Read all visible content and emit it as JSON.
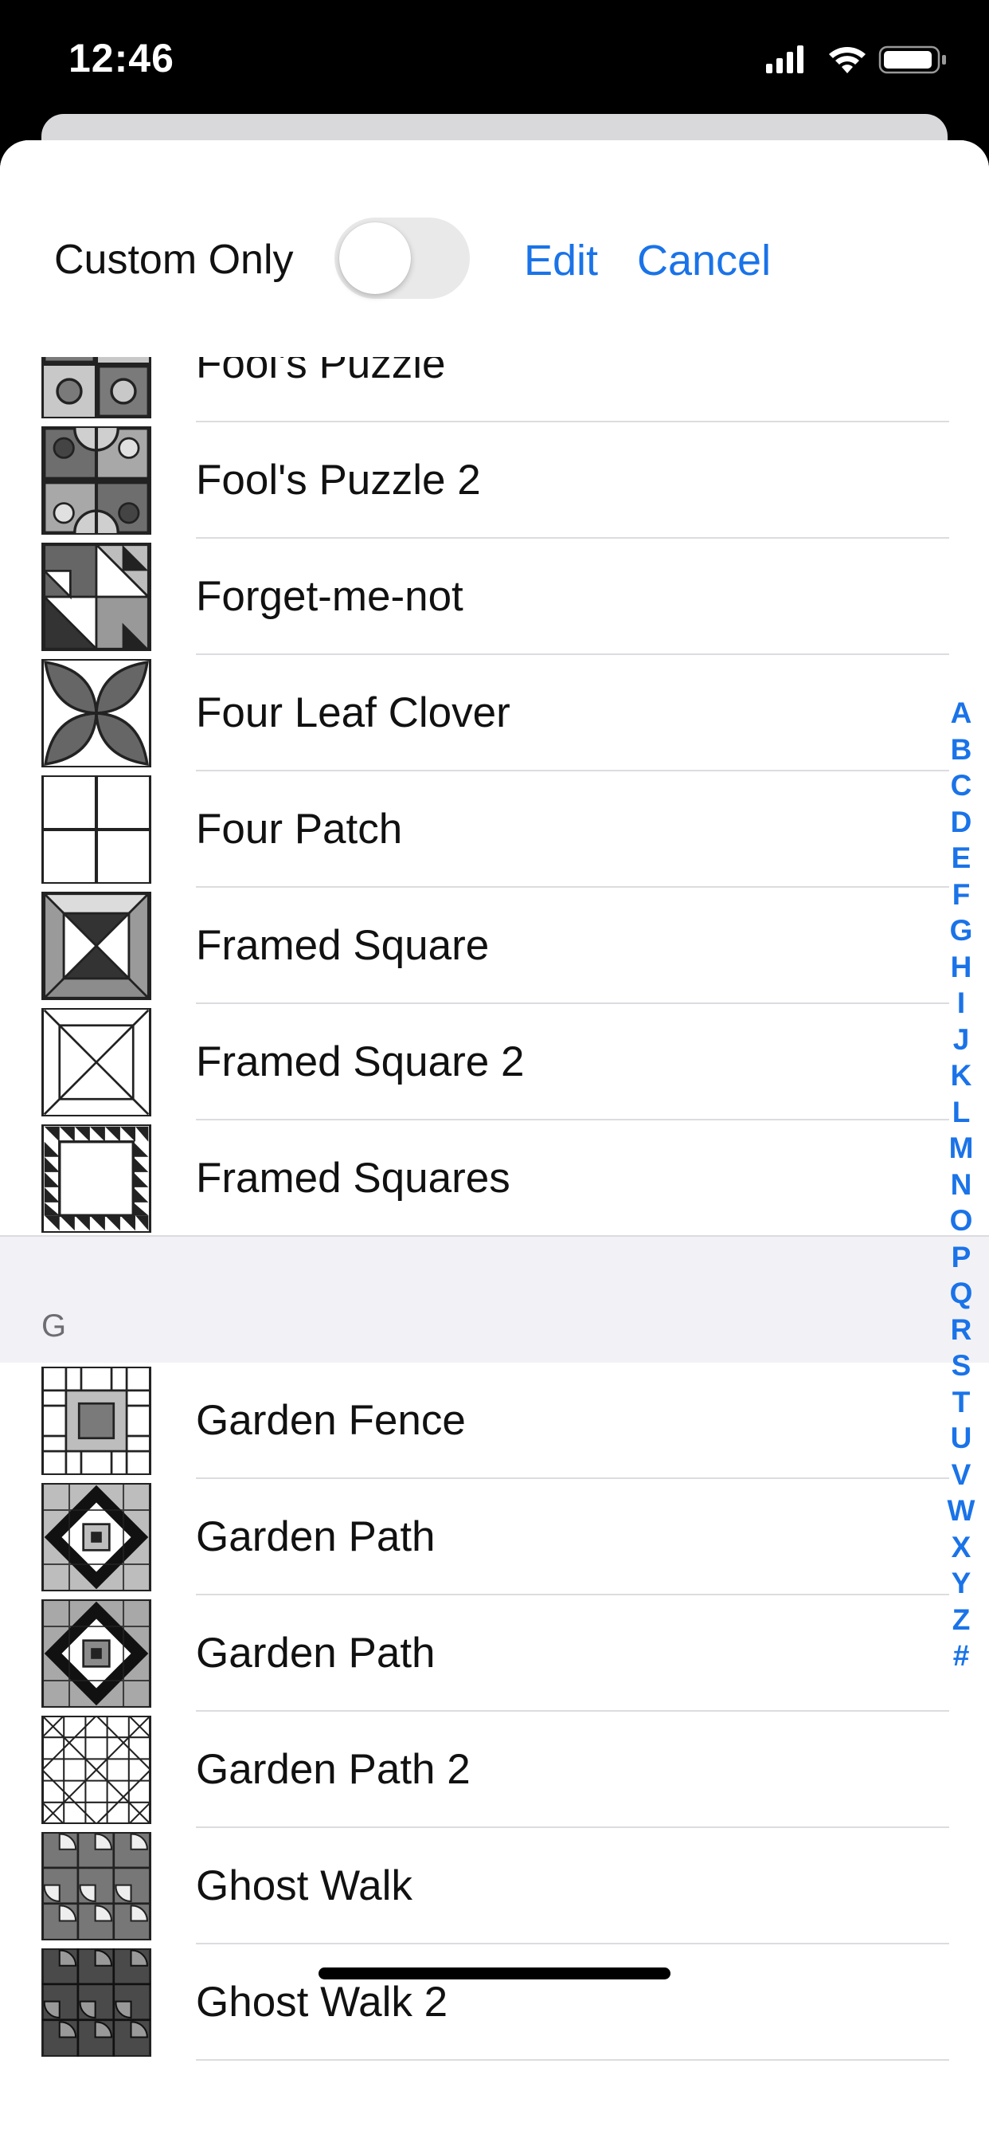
{
  "status_bar": {
    "time": "12:46"
  },
  "header": {
    "custom_only_label": "Custom Only",
    "custom_only_on": false,
    "edit_label": "Edit",
    "cancel_label": "Cancel"
  },
  "list": {
    "rows_f": [
      {
        "label": "Fool's Puzzle",
        "icon": "fools-puzzle-block"
      },
      {
        "label": "Fool's Puzzle 2",
        "icon": "fools-puzzle-2-block"
      },
      {
        "label": "Forget-me-not",
        "icon": "forget-me-not-block"
      },
      {
        "label": "Four Leaf Clover",
        "icon": "four-leaf-clover-block"
      },
      {
        "label": "Four Patch",
        "icon": "four-patch-block"
      },
      {
        "label": "Framed Square",
        "icon": "framed-square-block"
      },
      {
        "label": "Framed Square 2",
        "icon": "framed-square-2-block"
      },
      {
        "label": "Framed Squares",
        "icon": "framed-squares-block"
      }
    ],
    "section_g": "G",
    "rows_g": [
      {
        "label": "Garden Fence",
        "icon": "garden-fence-block"
      },
      {
        "label": "Garden Path",
        "icon": "garden-path-block"
      },
      {
        "label": "Garden Path",
        "icon": "garden-path-block"
      },
      {
        "label": "Garden Path 2",
        "icon": "garden-path-2-block"
      },
      {
        "label": "Ghost Walk",
        "icon": "ghost-walk-block"
      },
      {
        "label": "Ghost Walk 2",
        "icon": "ghost-walk-2-block"
      }
    ]
  },
  "section_index": [
    "A",
    "B",
    "C",
    "D",
    "E",
    "F",
    "G",
    "H",
    "I",
    "J",
    "K",
    "L",
    "M",
    "N",
    "O",
    "P",
    "Q",
    "R",
    "S",
    "T",
    "U",
    "V",
    "W",
    "X",
    "Y",
    "Z",
    "#"
  ],
  "colors": {
    "accent": "#1a73e8",
    "section_bg": "#f2f2f6",
    "separator": "#dcdce0"
  }
}
